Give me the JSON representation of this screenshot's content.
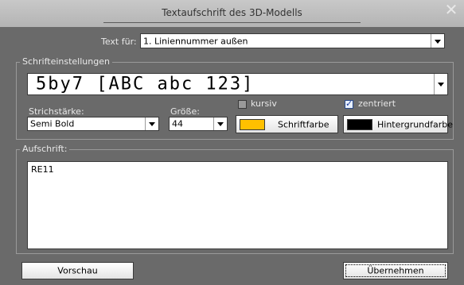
{
  "window": {
    "title": "Textaufschrift des 3D-Modells",
    "close_icon": "close-icon"
  },
  "text_for": {
    "label": "Text für:",
    "value": "1. Liniennummer außen"
  },
  "font_settings": {
    "group_label": "Schrifteinstellungen",
    "font_value": "5by7 [ABC abc 123]",
    "stroke_label": "Strichstärke:",
    "stroke_value": "Semi Bold",
    "size_label": "Größe:",
    "size_value": "44",
    "italic_label": "kursiv",
    "italic_checked": false,
    "centered_label": "zentriert",
    "centered_checked": true,
    "font_color_label": "Schriftfarbe",
    "font_color": "#ffc000",
    "bg_color_label": "Hintergrundfarbe",
    "bg_color": "#000000"
  },
  "inscription": {
    "group_label": "Aufschrift:",
    "text": "RE11"
  },
  "buttons": {
    "preview": "Vorschau",
    "apply": "Übernehmen"
  }
}
